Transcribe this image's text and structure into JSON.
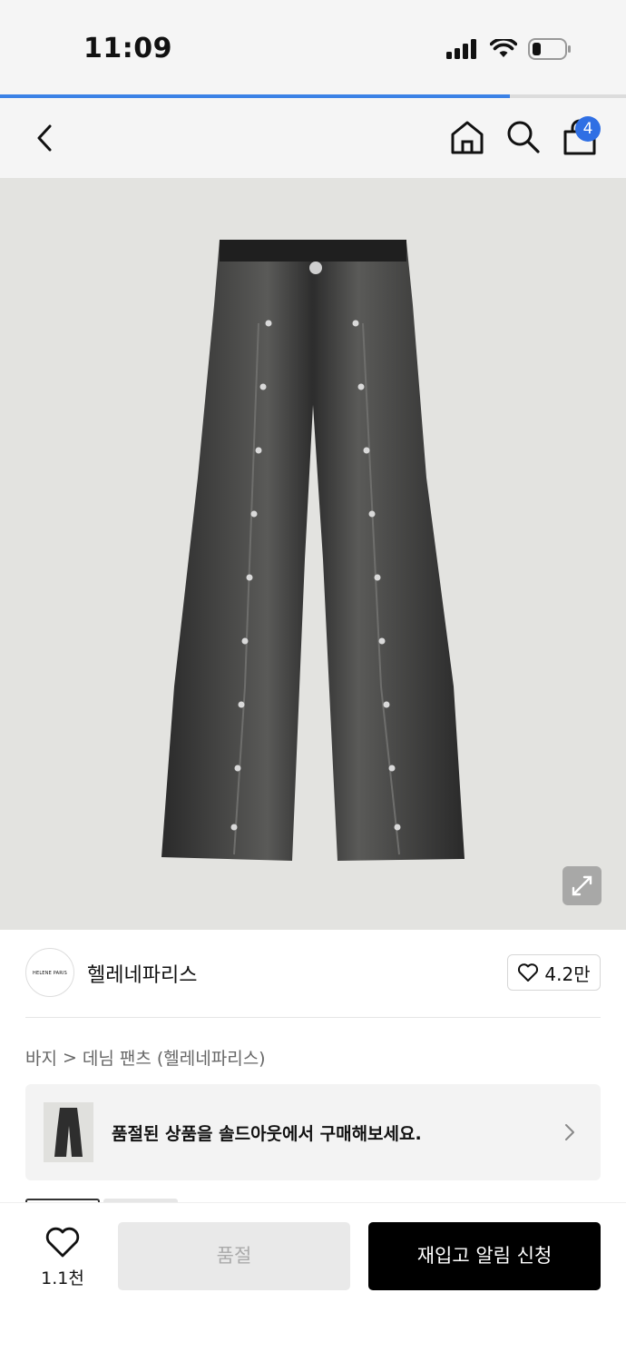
{
  "status_bar": {
    "time": "11:09"
  },
  "page_progress": 0.815,
  "nav": {
    "cart_count": "4"
  },
  "brand": {
    "logo_text": "HELENE PARIS",
    "name": "헬레네파리스",
    "likes": "4.2만"
  },
  "breadcrumb": {
    "category": "바지",
    "separator": ">",
    "subcategory": "데님 팬츠 (헬레네파리스)"
  },
  "soldout_banner": {
    "text": "품절된 상품을 솔드아웃에서 구매해보세요."
  },
  "bottom": {
    "wish_count": "1.1천",
    "soldout_label": "품절",
    "restock_label": "재입고 알림 신청"
  },
  "colors": {
    "accent": "#2f6fe4",
    "progress": "#3b82e6",
    "cta": "#000000"
  }
}
